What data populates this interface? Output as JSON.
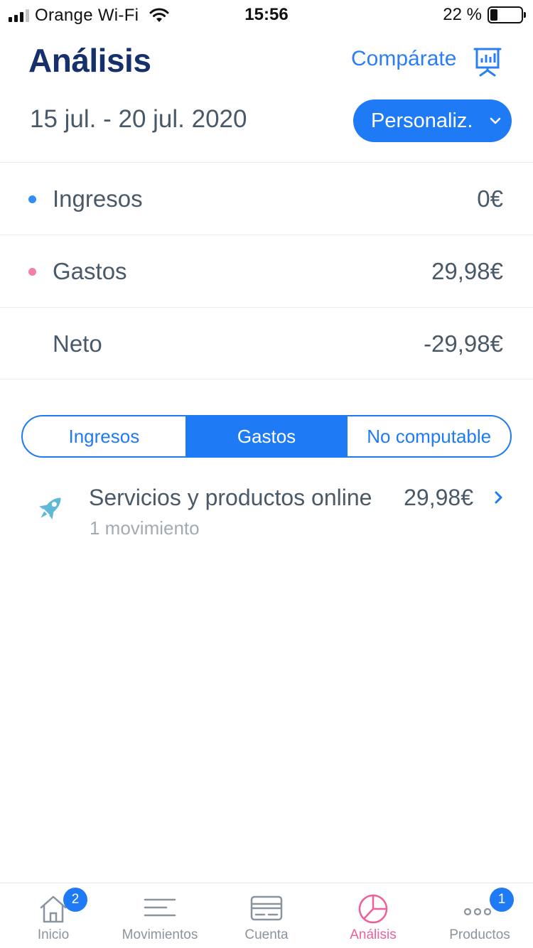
{
  "status_bar": {
    "carrier": "Orange Wi-Fi",
    "time": "15:56",
    "battery_percent": "22 %",
    "battery_level": 0.22
  },
  "header": {
    "title": "Análisis",
    "compare_label": "Compárate",
    "compare_icon": "presentation-chart-icon"
  },
  "period": {
    "date_range": "15 jul. - 20 jul. 2020",
    "selector_label": "Personaliz."
  },
  "summary": {
    "rows": [
      {
        "label": "Ingresos",
        "value": "0€",
        "dot_color": "#2f8ff2"
      },
      {
        "label": "Gastos",
        "value": "29,98€",
        "dot_color": "#f47fa8"
      },
      {
        "label": "Neto",
        "value": "-29,98€"
      }
    ]
  },
  "segments": {
    "items": [
      "Ingresos",
      "Gastos",
      "No computable"
    ],
    "active": "Gastos"
  },
  "categories": [
    {
      "name": "Servicios y productos online",
      "count": "1 movimiento",
      "amount": "29,98€",
      "icon": "rocket-icon",
      "icon_color": "#5fb8d6"
    }
  ],
  "tabbar": {
    "tabs": [
      {
        "label": "Inicio",
        "icon": "home-icon",
        "badge": "2"
      },
      {
        "label": "Movimientos",
        "icon": "list-icon"
      },
      {
        "label": "Cuenta",
        "icon": "card-icon"
      },
      {
        "label": "Análisis",
        "icon": "pie-chart-icon",
        "active": true
      },
      {
        "label": "Productos",
        "icon": "more-icon",
        "badge": "1"
      }
    ]
  },
  "colors": {
    "primary": "#1f7af5",
    "title": "#15306b",
    "text": "#4a5968",
    "muted": "#a2abb4",
    "active_tab": "#ef5f9a"
  }
}
